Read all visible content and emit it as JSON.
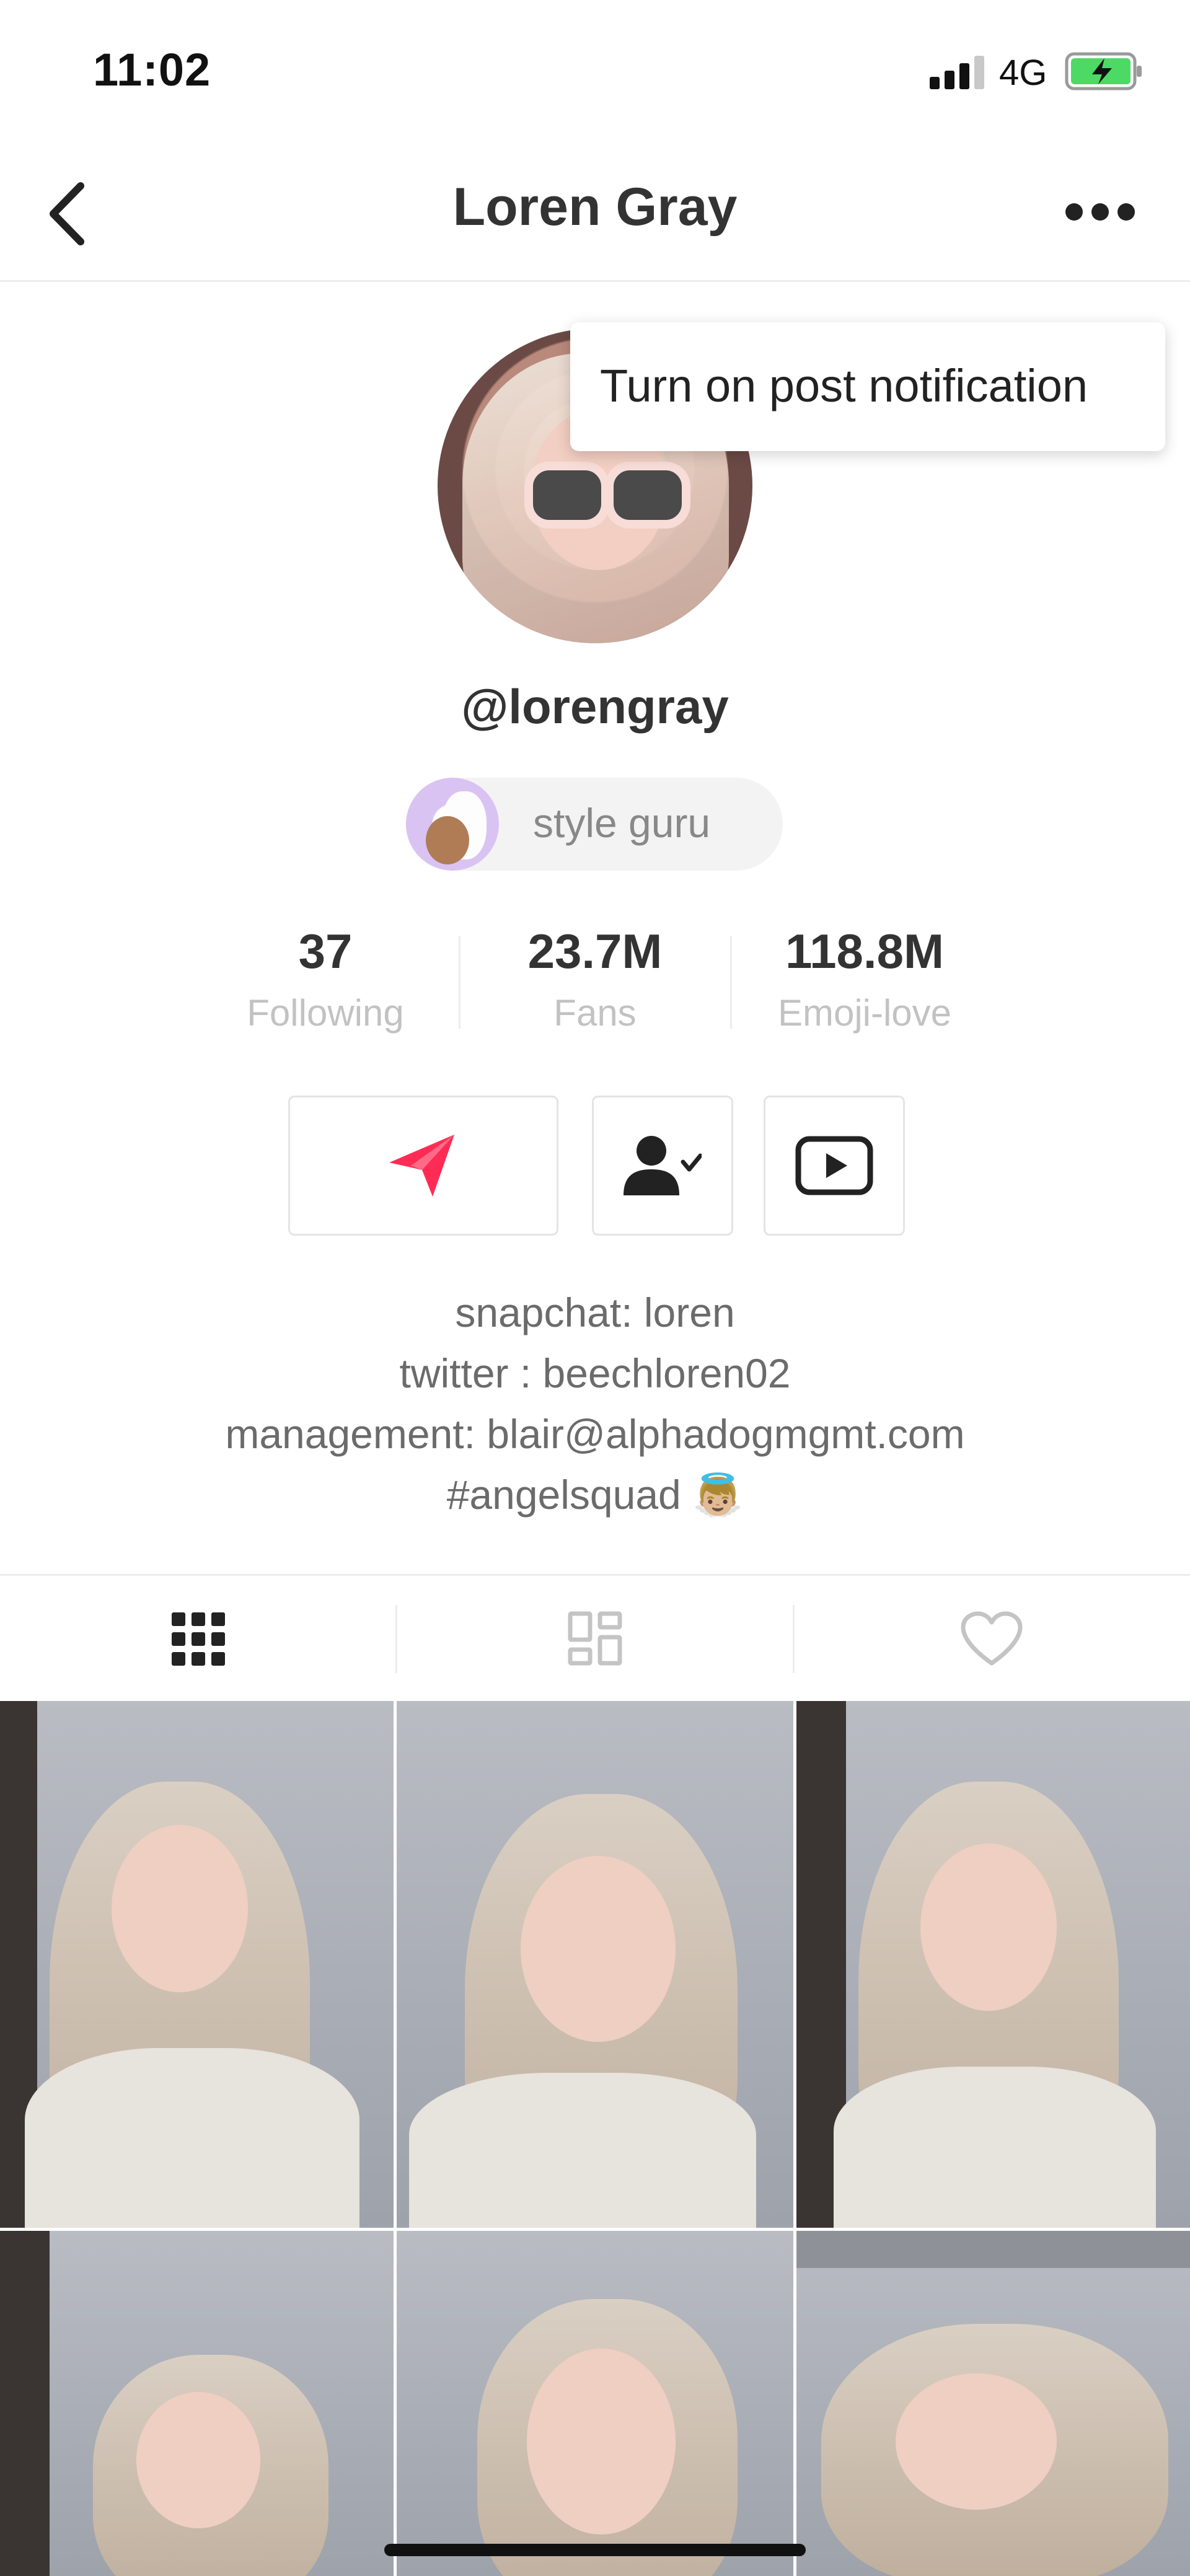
{
  "status_bar": {
    "time": "11:02",
    "network": "4G"
  },
  "nav": {
    "title": "Loren Gray"
  },
  "popup": {
    "text": "Turn on post notification"
  },
  "profile": {
    "username": "@lorengray",
    "badge_label": "style guru"
  },
  "stats": [
    {
      "value": "37",
      "label": "Following"
    },
    {
      "value": "23.7M",
      "label": "Fans"
    },
    {
      "value": "118.8M",
      "label": "Emoji-love"
    }
  ],
  "bio": {
    "line1": "snapchat: loren",
    "line2": "twitter : beechloren02",
    "line3": "management: blair@alphadogmgmt.com",
    "line4": "#angelsquad 👼🏼"
  },
  "tabs": [
    "videos-grid",
    "duets-grid",
    "liked"
  ],
  "colors": {
    "accent": "#fe2c55",
    "icon": "#222222",
    "muted": "#c2c2c2"
  }
}
